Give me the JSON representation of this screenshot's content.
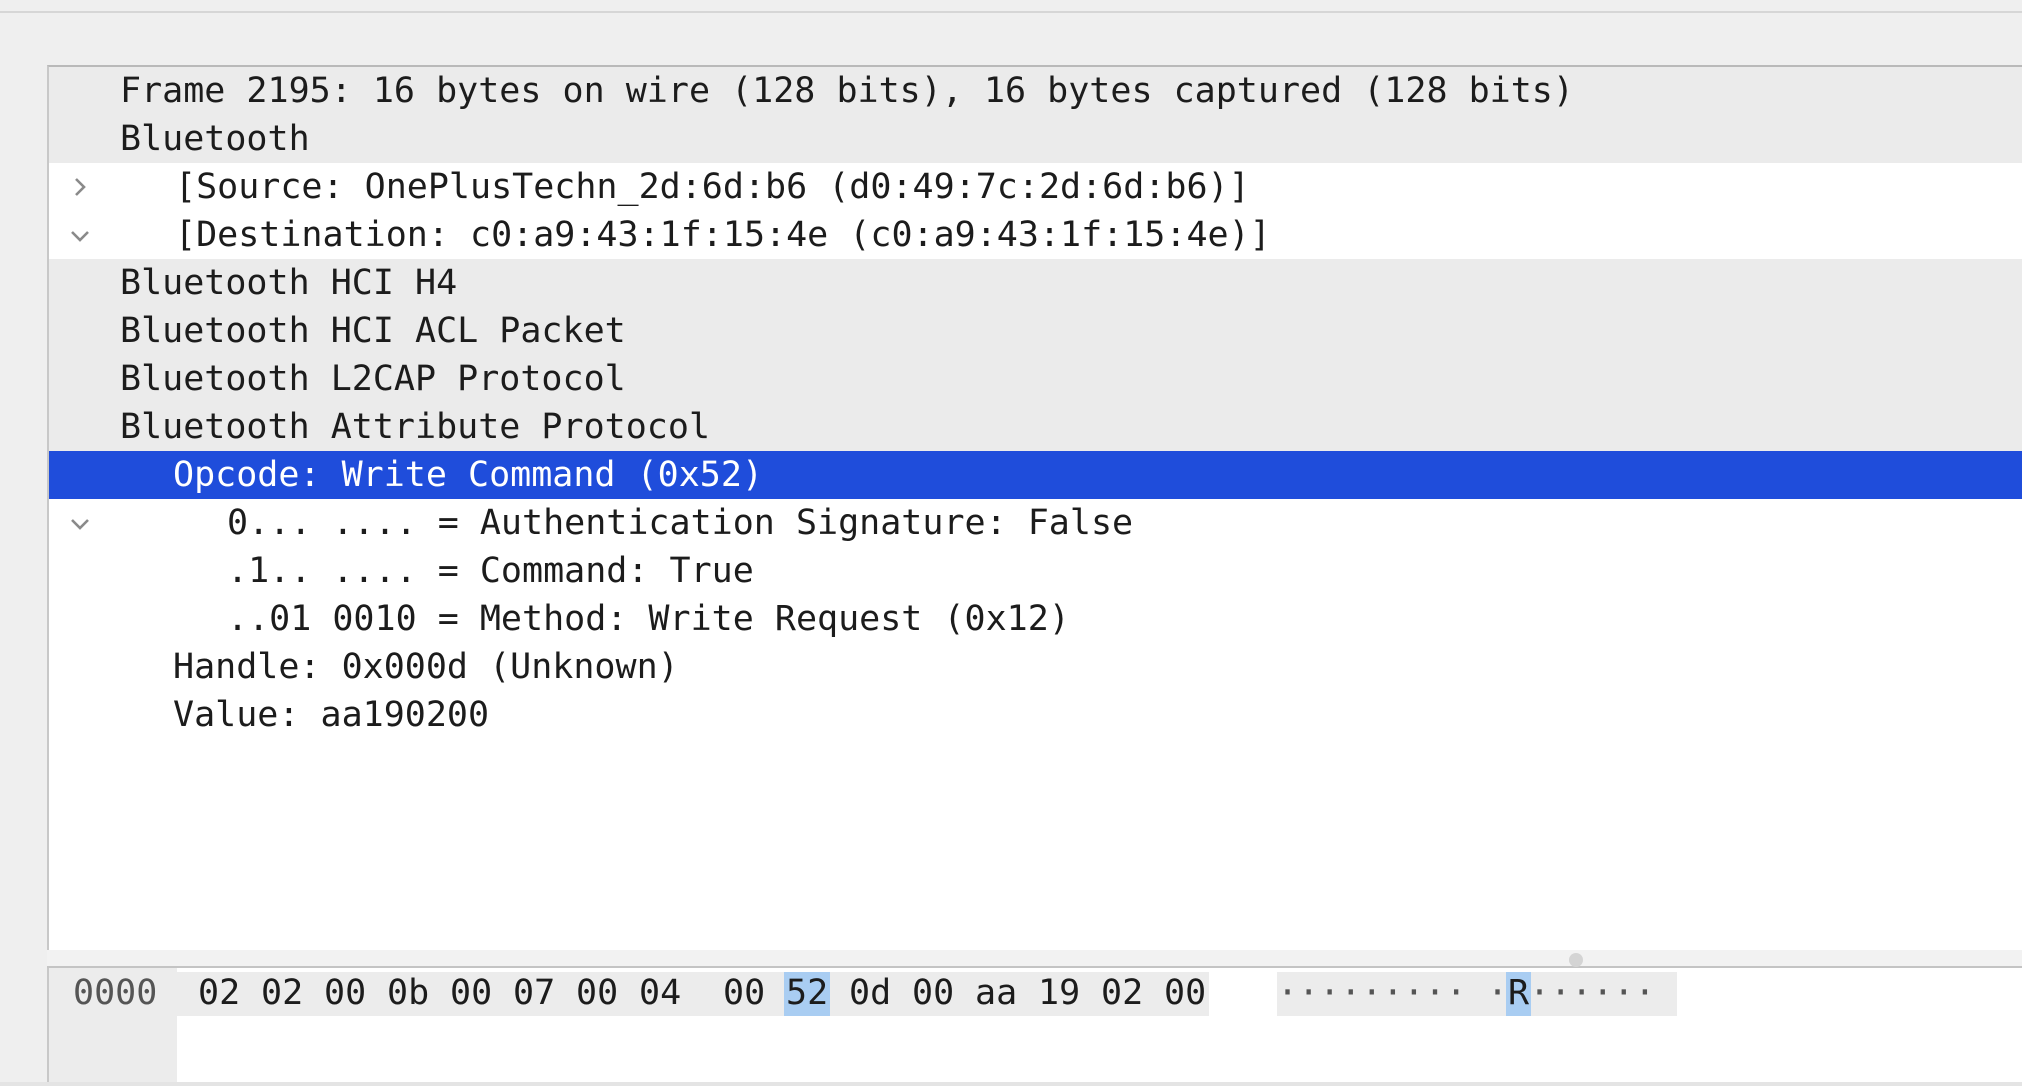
{
  "colors": {
    "selection": "#1f4ddb",
    "byte_highlight": "#a9cdf2",
    "shaded_row": "#ebebeb"
  },
  "tree": {
    "rows": [
      {
        "label": "Frame 2195: 16 bytes on wire (128 bits), 16 bytes captured (128 bits)",
        "expander": "chevron-right-icon"
      },
      {
        "label": "Bluetooth",
        "expander": "chevron-down-icon"
      },
      {
        "label": "[Source: OnePlusTechn_2d:6d:b6 (d0:49:7c:2d:6d:b6)]"
      },
      {
        "label": "[Destination: c0:a9:43:1f:15:4e (c0:a9:43:1f:15:4e)]"
      },
      {
        "label": "Bluetooth HCI H4",
        "expander": "chevron-right-icon"
      },
      {
        "label": "Bluetooth HCI ACL Packet",
        "expander": "chevron-right-icon"
      },
      {
        "label": "Bluetooth L2CAP Protocol",
        "expander": "chevron-right-icon"
      },
      {
        "label": "Bluetooth Attribute Protocol",
        "expander": "chevron-down-icon"
      },
      {
        "label": "Opcode: Write Command (0x52)",
        "expander": "chevron-down-icon",
        "selected": true
      },
      {
        "label": "0... .... = Authentication Signature: False"
      },
      {
        "label": ".1.. .... = Command: True"
      },
      {
        "label": "..01 0010 = Method: Write Request (0x12)"
      },
      {
        "label": "Handle: 0x000d (Unknown)"
      },
      {
        "label": "Value: aa190200"
      }
    ]
  },
  "bytes_pane": {
    "offset": "0000",
    "hex": [
      "02",
      "02",
      "00",
      "0b",
      "00",
      "07",
      "00",
      "04",
      "00",
      "52",
      "0d",
      "00",
      "aa",
      "19",
      "02",
      "00"
    ],
    "ascii_before": "·········",
    "ascii_gap": " ",
    "ascii_lead": "·",
    "ascii_highlight": "R",
    "ascii_after": "······",
    "highlighted_byte": "52"
  }
}
